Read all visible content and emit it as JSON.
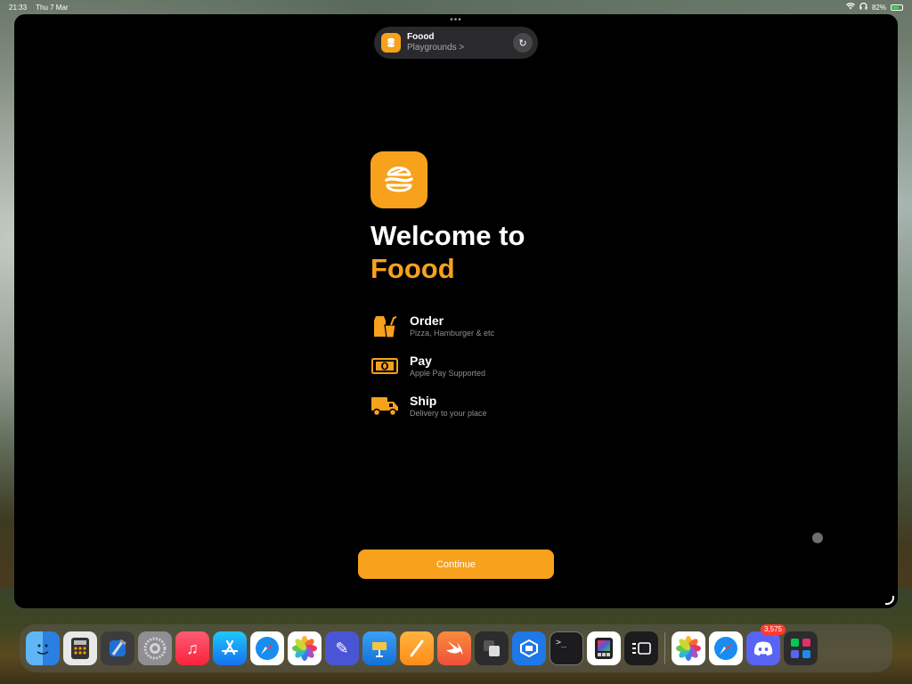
{
  "statusbar": {
    "time": "21:33",
    "date": "Thu 7 Mar",
    "battery": "82%"
  },
  "runbar": {
    "app_name": "Foood",
    "subtitle": "Playgrounds >"
  },
  "welcome": {
    "line1": "Welcome to",
    "brand": "Foood"
  },
  "features": [
    {
      "icon": "takeout-bag-cup-icon",
      "title": "Order",
      "subtitle": "Pizza, Hamburger & etc"
    },
    {
      "icon": "banknote-icon",
      "title": "Pay",
      "subtitle": "Apple Pay Supported"
    },
    {
      "icon": "delivery-truck-icon",
      "title": "Ship",
      "subtitle": "Delivery to your place"
    }
  ],
  "continue_label": "Continue",
  "colors": {
    "accent": "#f7a11c",
    "background": "#000000"
  },
  "dock": {
    "apps": [
      "finder-icon",
      "calculator-icon",
      "xcode-icon",
      "system-settings-icon",
      "music-icon",
      "app-store-icon",
      "safari-icon",
      "photos-icon",
      "sketch-pencil-icon",
      "keynote-icon",
      "pages-icon",
      "swift-playgrounds-icon",
      "stage-manager-icon",
      "app-blueprint-icon",
      "terminal-icon",
      "color-ui-icon",
      "display-layout-icon"
    ],
    "recent": [
      "photos-icon",
      "safari-icon",
      "discord-icon",
      "app-folder-icon"
    ],
    "discord_badge": "3,575"
  }
}
